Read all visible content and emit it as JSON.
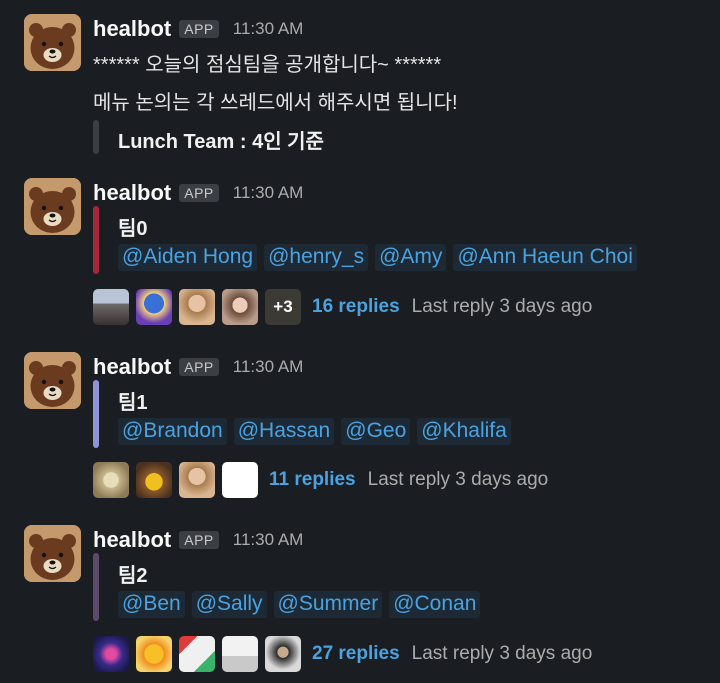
{
  "messages": [
    {
      "sender": "healbot",
      "badge": "APP",
      "time": "11:30 AM",
      "line1": "****** 오늘의 점심팀을 공개합니다~   ******",
      "line2": "메뉴 논의는 각 쓰레드에서 해주시면 됩니다!",
      "attachment_title": "Lunch Team : 4인 기준"
    },
    {
      "sender": "healbot",
      "badge": "APP",
      "time": "11:30 AM",
      "team": "팀0",
      "bar_color": "#a7283a",
      "mentions": [
        "@Aiden Hong",
        "@henry_s",
        "@Amy",
        "@Ann Haeun Choi"
      ],
      "extra_count": "+3",
      "reply_count": "16 replies",
      "last_reply": "Last reply 3 days ago"
    },
    {
      "sender": "healbot",
      "badge": "APP",
      "time": "11:30 AM",
      "team": "팀1",
      "bar_color": "#8b95d8",
      "mentions": [
        "@Brandon",
        "@Hassan",
        "@Geo",
        "@Khalifa"
      ],
      "reply_count": "11 replies",
      "last_reply": "Last reply 3 days ago"
    },
    {
      "sender": "healbot",
      "badge": "APP",
      "time": "11:30 AM",
      "team": "팀2",
      "bar_color": "#5b4a6a",
      "mentions": [
        "@Ben",
        "@Sally",
        "@Summer",
        "@Conan"
      ],
      "reply_count": "27 replies",
      "last_reply": "Last reply 3 days ago"
    }
  ],
  "colors": {
    "background": "#1a1d21",
    "link": "#4aa3e0",
    "mention_bg": "#1d2a36"
  }
}
